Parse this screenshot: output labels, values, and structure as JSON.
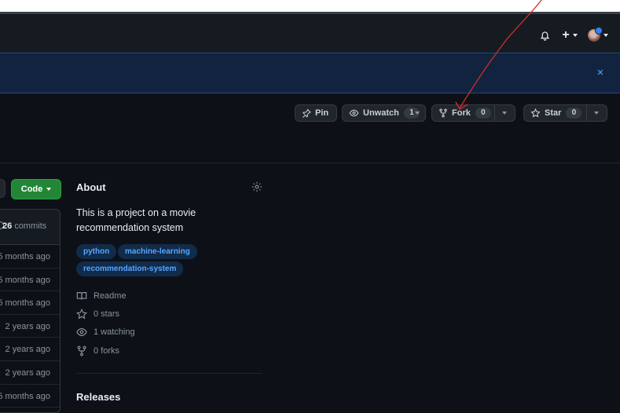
{
  "header": {
    "notifications_icon": "bell-icon",
    "create_icon": "plus-icon",
    "avatar_icon": "avatar"
  },
  "banner": {
    "close_glyph": "×"
  },
  "actions": {
    "pin_label": "Pin",
    "unwatch_label": "Unwatch",
    "watch_count": "1",
    "fork_label": "Fork",
    "fork_count": "0",
    "star_label": "Star",
    "star_count": "0"
  },
  "code_button": {
    "label": "Code"
  },
  "files": {
    "commit_count": "26",
    "commits_label": "commits",
    "rows": [
      "5 months ago",
      "5 months ago",
      "5 months ago",
      "2 years ago",
      "2 years ago",
      "2 years ago",
      "5 months ago"
    ]
  },
  "about": {
    "title": "About",
    "description": "This is a project on a movie recommendation system",
    "topics": [
      "python",
      "machine-learning",
      "recommendation-system"
    ],
    "readme": "Readme",
    "stars": "0 stars",
    "watching": "1 watching",
    "forks": "0 forks",
    "releases_title": "Releases"
  },
  "colors": {
    "background": "#0d1117",
    "banner": "#11233f",
    "code_green": "#238636",
    "topic_blue": "#58a6ff",
    "annotation_red": "#d62b2b"
  }
}
